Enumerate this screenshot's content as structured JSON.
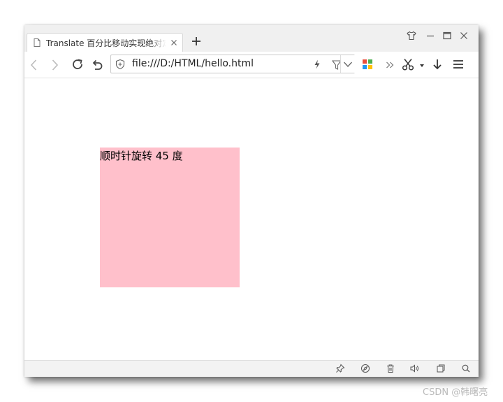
{
  "tab": {
    "title": "Translate 百分比移动实现绝对定位居中"
  },
  "toolbar": {
    "url": "file:///D:/HTML/hello.html"
  },
  "content": {
    "box_text": "顺时针旋转 45 度"
  },
  "watermark": "CSDN @韩曙亮",
  "icons": {
    "tab": [
      "page-icon",
      "close-icon",
      "plus-icon"
    ],
    "window": [
      "shirt-icon",
      "minimize-icon",
      "maximize-icon",
      "close-icon"
    ],
    "toolbar": [
      "back-icon",
      "forward-icon",
      "reload-icon",
      "undo-icon",
      "shield-icon",
      "bolt-icon",
      "filter-icon",
      "chevron-down-icon",
      "apps-grid-icon",
      "double-chevron-icon",
      "scissors-icon",
      "caret-down-icon",
      "download-icon",
      "menu-icon"
    ],
    "status": [
      "pin-icon",
      "compass-icon",
      "trash-icon",
      "speaker-icon",
      "window-icon",
      "magnifier-icon"
    ]
  },
  "colors": {
    "box_background": "#ffc0cb",
    "titlebar_background": "#f0f0f0",
    "statusbar_background": "#f3f3f3",
    "apps_grid": [
      "#e94e3c",
      "#4caf50",
      "#2196f3",
      "#ffc107"
    ]
  }
}
